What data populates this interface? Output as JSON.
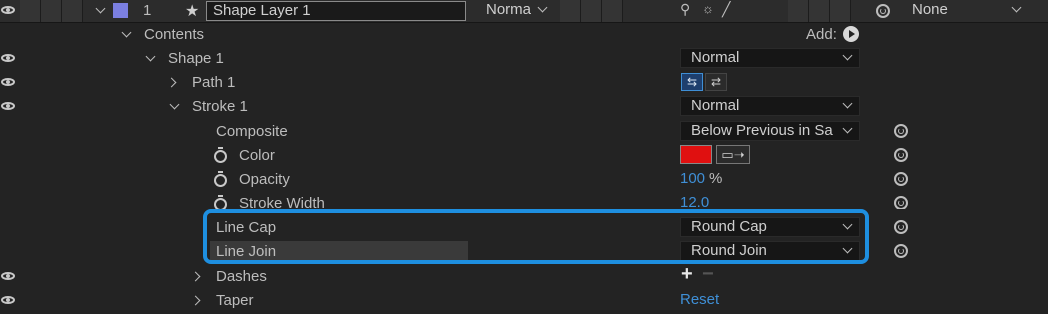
{
  "layer": {
    "number": "1",
    "name": "Shape Layer 1",
    "mode": "Norma",
    "parent": "None",
    "label_color": "#7b7fe0"
  },
  "contents": {
    "label": "Contents",
    "add_label": "Add:"
  },
  "shape": {
    "label": "Shape 1",
    "blend": "Normal"
  },
  "path": {
    "label": "Path 1"
  },
  "stroke": {
    "label": "Stroke 1",
    "blend": "Normal",
    "composite_label": "Composite",
    "composite_value": "Below Previous in Sa",
    "color_label": "Color",
    "color_value": "#e01010",
    "opacity_label": "Opacity",
    "opacity_value": "100",
    "opacity_unit": "%",
    "width_label": "Stroke Width",
    "width_value": "12.0",
    "line_cap_label": "Line Cap",
    "line_cap_value": "Round Cap",
    "line_join_label": "Line Join",
    "line_join_value": "Round Join",
    "dashes_label": "Dashes",
    "taper_label": "Taper",
    "taper_reset": "Reset"
  },
  "colors": {
    "highlight": "#1e8fe0",
    "value_blue": "#3f8fd6"
  }
}
